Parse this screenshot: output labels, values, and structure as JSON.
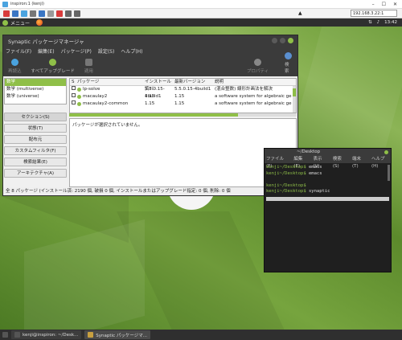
{
  "viewer": {
    "title": "inspiron:1 (kenji)",
    "address": "192.168.3.22:1"
  },
  "top_panel": {
    "menu_label": "メニュー",
    "clock": "13:42"
  },
  "synaptic": {
    "title": "Synaptic パッケージマネージャ",
    "menu": [
      "ファイル(F)",
      "編集(E)",
      "パッケージ(P)",
      "設定(S)",
      "ヘルプ(H)"
    ],
    "toolbar": {
      "reload": "再読込",
      "mark_all": "すべてアップグレード",
      "apply": "適用",
      "properties": "プロパティ",
      "search": "検索"
    },
    "sections": {
      "items": [
        "数学",
        "数学 (multiverse)",
        "数学 (universe)"
      ],
      "selected_index": 0
    },
    "filter_buttons": [
      "セクション(S)",
      "状態(T)",
      "配布元",
      "カスタムフィルタ(F)",
      "検索結果(E)",
      "アーキテクチャ(A)"
    ],
    "table": {
      "headers": [
        "S",
        "パッケージ",
        "インストール済バ",
        "最新バージョン",
        "説明"
      ],
      "rows": [
        {
          "name": "lp-solve",
          "installed": "5.5.0.15-4build1",
          "latest": "5.5.0.15-4build1",
          "desc": "(混合整数) 線形計画法を解決"
        },
        {
          "name": "macaulay2",
          "installed": "1.15",
          "latest": "1.15",
          "desc": "a software system for algebraic ge"
        },
        {
          "name": "macaulay2-common",
          "installed": "1.15",
          "latest": "1.15",
          "desc": "a software system for algebraic ge"
        }
      ]
    },
    "detail_text": "パッケージが選択されていません。",
    "status": "全 8 パッケージ (インストール済: 2190 個, 破損 0 個, インストールまたはアップグレード指定: 0 個, 削除: 0 個"
  },
  "terminal": {
    "title": "~/Desktop",
    "menu": [
      "ファイル(F)",
      "編集(E)",
      "表示(V)",
      "検索(S)",
      "端末(T)",
      "ヘルプ(H)"
    ],
    "lines": [
      {
        "prompt": "kenji~/Desktop$",
        "cmd": " emacs"
      },
      {
        "prompt": "kenji~/Desktop$",
        "cmd": " emacs"
      },
      {
        "prompt": "",
        "cmd": ""
      },
      {
        "prompt": "kenji~/Desktop$",
        "cmd": ""
      },
      {
        "prompt": "kenji~/Desktop$",
        "cmd": " synaptic"
      }
    ]
  },
  "taskbar": {
    "items": [
      "kenji@inspiron: ~/Desk...",
      "Synaptic パッケージマ..."
    ]
  }
}
